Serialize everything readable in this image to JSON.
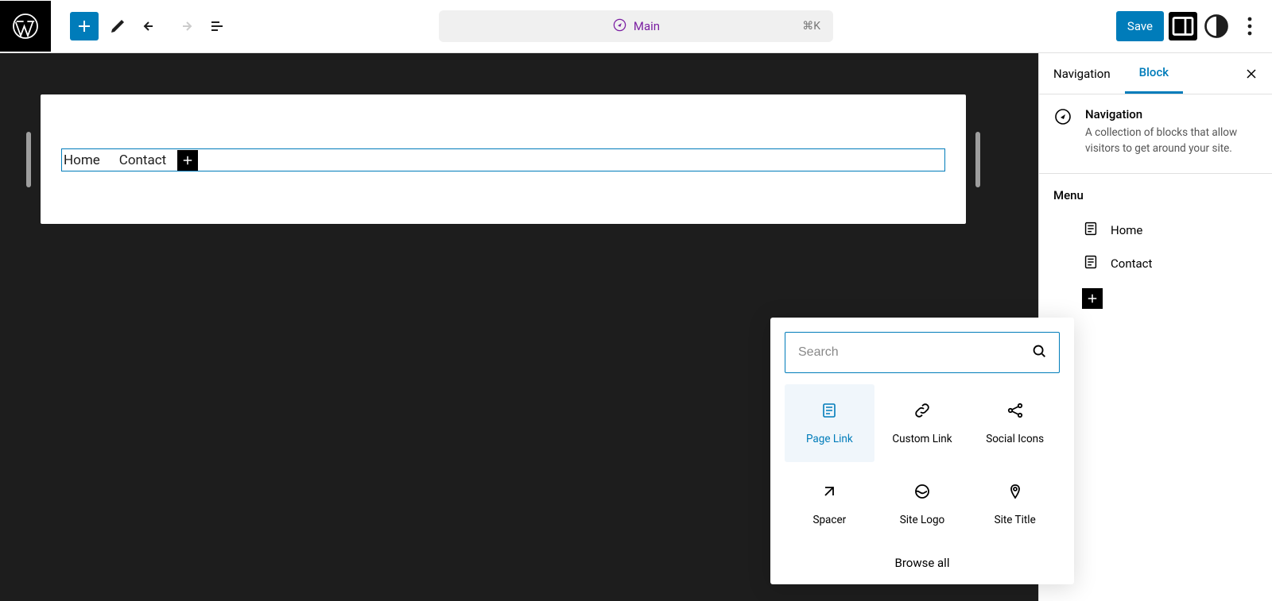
{
  "command": {
    "title": "Main",
    "shortcut": "⌘K"
  },
  "toolbar": {
    "save_label": "Save"
  },
  "sidebar": {
    "tabs": {
      "nav": "Navigation",
      "block": "Block"
    },
    "block": {
      "title": "Navigation",
      "desc": "A collection of blocks that allow visitors to get around your site."
    },
    "menu": {
      "heading": "Menu",
      "items": [
        "Home",
        "Contact"
      ]
    }
  },
  "nav": {
    "items": [
      "Home",
      "Contact"
    ]
  },
  "inserter": {
    "search_placeholder": "Search",
    "blocks": [
      {
        "label": "Page Link"
      },
      {
        "label": "Custom Link"
      },
      {
        "label": "Social Icons"
      },
      {
        "label": "Spacer"
      },
      {
        "label": "Site Logo"
      },
      {
        "label": "Site Title"
      }
    ],
    "browse_label": "Browse all"
  }
}
